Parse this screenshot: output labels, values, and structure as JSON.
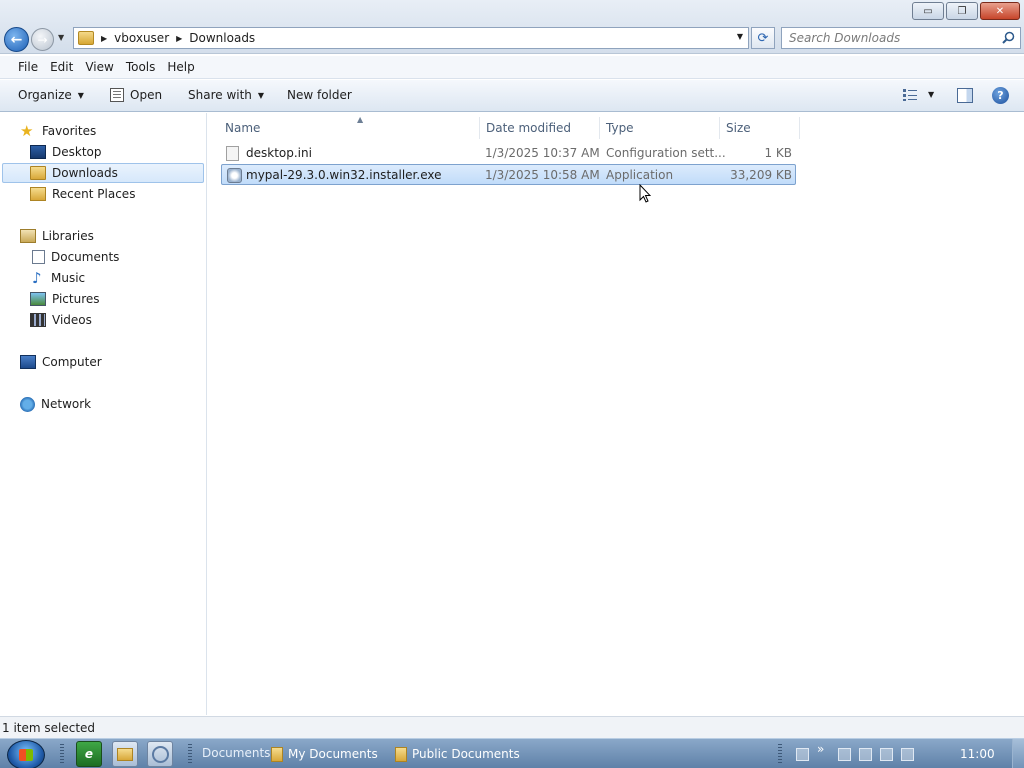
{
  "window": {
    "controls": {
      "minimize": "▭",
      "maximize": "❐",
      "close": "✕"
    }
  },
  "address": {
    "crumbs": [
      "vboxuser",
      "Downloads"
    ]
  },
  "search": {
    "placeholder": "Search Downloads"
  },
  "menu": [
    "File",
    "Edit",
    "View",
    "Tools",
    "Help"
  ],
  "commands": {
    "organize": "Organize",
    "open": "Open",
    "share_with": "Share with",
    "new_folder": "New folder"
  },
  "nav": {
    "favorites": {
      "label": "Favorites",
      "items": [
        "Desktop",
        "Downloads",
        "Recent Places"
      ]
    },
    "libraries": {
      "label": "Libraries",
      "items": [
        "Documents",
        "Music",
        "Pictures",
        "Videos"
      ]
    },
    "computer": "Computer",
    "network": "Network",
    "selected": "Downloads"
  },
  "columns": [
    "Name",
    "Date modified",
    "Type",
    "Size"
  ],
  "files": [
    {
      "name": "desktop.ini",
      "date": "1/3/2025 10:37 AM",
      "type": "Configuration sett...",
      "size": "1 KB",
      "icon": "ini-file-icon",
      "selected": false
    },
    {
      "name": "mypal-29.3.0.win32.installer.exe",
      "date": "1/3/2025 10:58 AM",
      "type": "Application",
      "size": "33,209 KB",
      "icon": "installer-exe-icon",
      "selected": true
    }
  ],
  "status": {
    "text": "1 item selected"
  },
  "taskbar": {
    "group_label": "Documents",
    "buttons": [
      "My Documents",
      "Public Documents"
    ],
    "clock": "11:00",
    "overflow": "»"
  },
  "colors": {
    "selection": "#c1dcfa",
    "taskbar": "#6d8eb3",
    "accent": "#1d5fb5"
  }
}
